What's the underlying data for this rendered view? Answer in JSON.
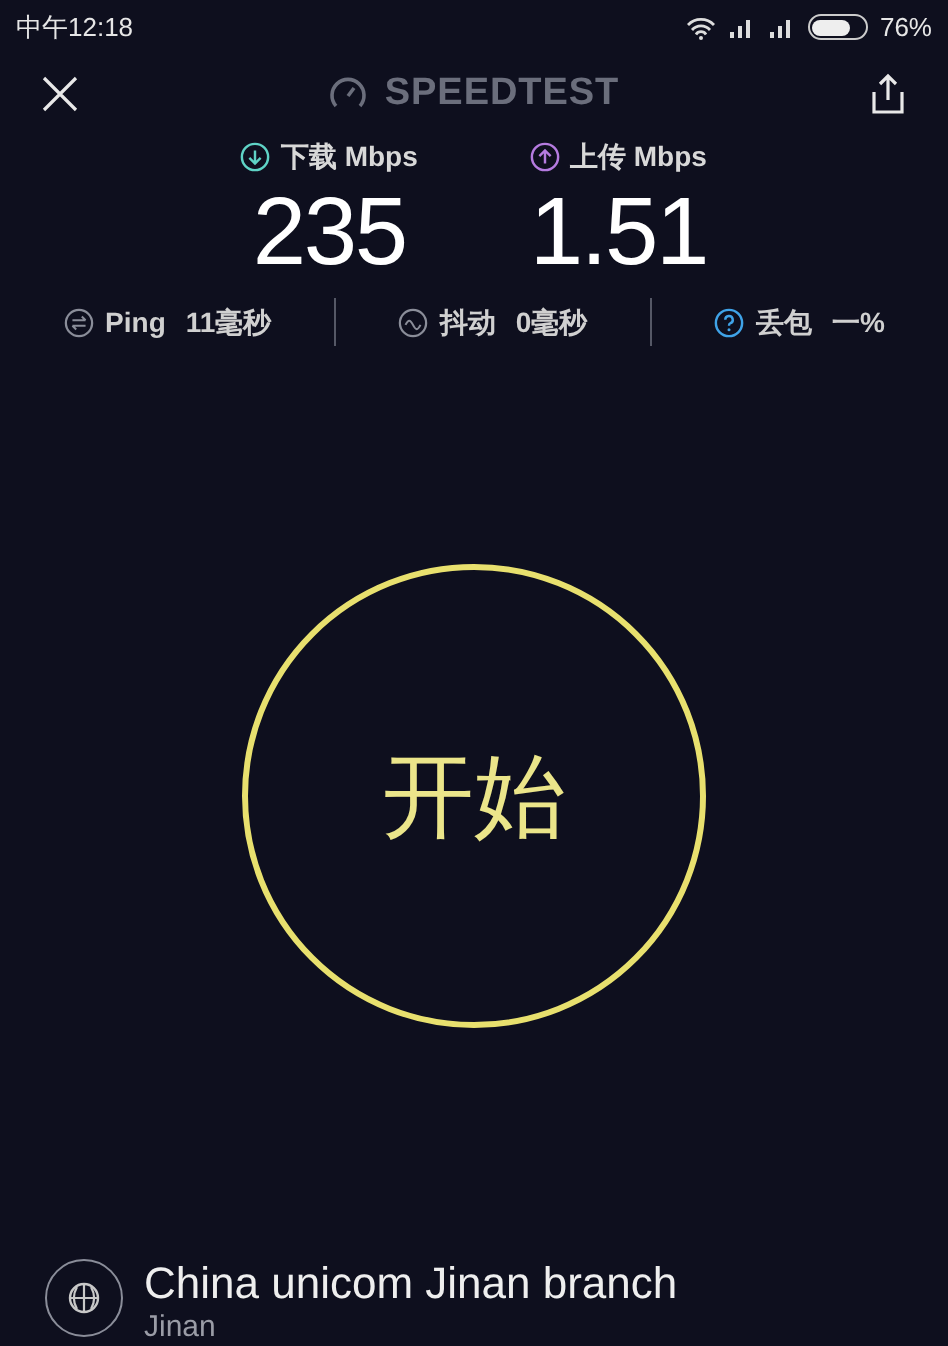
{
  "status_bar": {
    "time": "中午12:18",
    "battery_text": "76%"
  },
  "header": {
    "title": "SPEEDTEST"
  },
  "speeds": [
    {
      "kind": "download",
      "label": "下载 Mbps",
      "value": "235"
    },
    {
      "kind": "upload",
      "label": "上传 Mbps",
      "value": "1.51"
    }
  ],
  "stats": [
    {
      "kind": "ping",
      "label": "Ping",
      "value": "11毫秒"
    },
    {
      "kind": "jitter",
      "label": "抖动",
      "value": "0毫秒"
    },
    {
      "kind": "loss",
      "label": "丢包",
      "value": "一%"
    }
  ],
  "start_button": {
    "label": "开始"
  },
  "server": {
    "name": "China unicom Jinan branch",
    "location": "Jinan"
  }
}
